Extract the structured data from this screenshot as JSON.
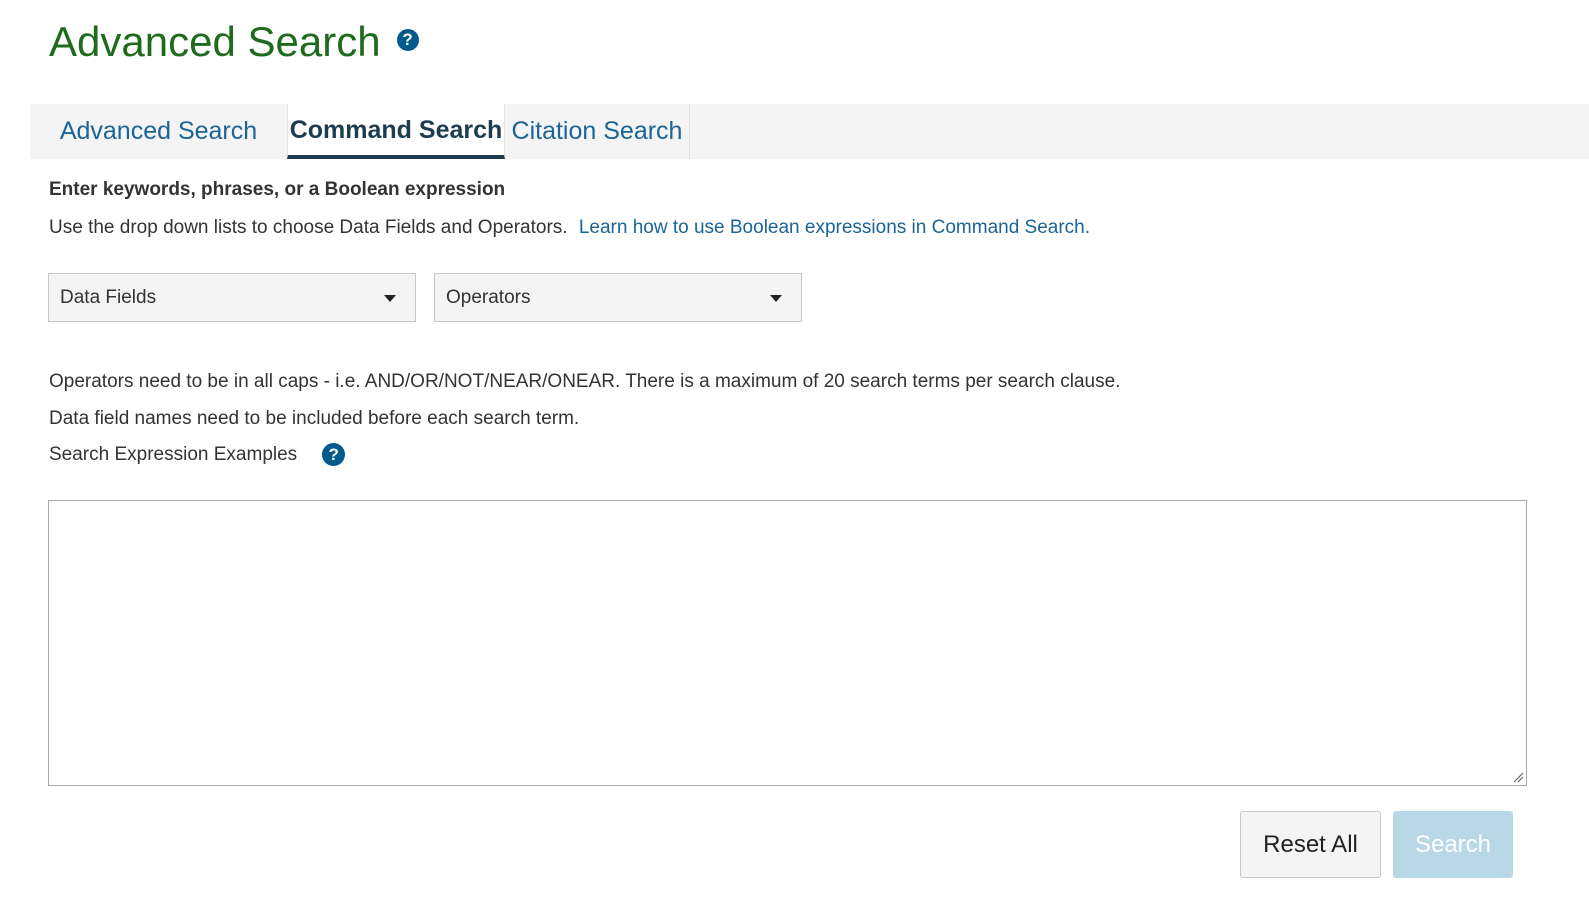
{
  "header": {
    "title": "Advanced Search",
    "help_glyph": "?"
  },
  "tabs": [
    {
      "label": "Advanced Search",
      "active": false
    },
    {
      "label": "Command Search",
      "active": true
    },
    {
      "label": "Citation Search",
      "active": false
    }
  ],
  "instructions": {
    "heading": "Enter keywords, phrases, or a Boolean expression",
    "text": "Use the drop down lists to choose Data Fields and Operators.",
    "link": "Learn how to use Boolean expressions in Command Search."
  },
  "dropdowns": {
    "data_fields": "Data Fields",
    "operators": "Operators"
  },
  "notes": {
    "line1": "Operators need to be in all caps - i.e. AND/OR/NOT/NEAR/ONEAR. There is a maximum of 20 search terms per search clause.",
    "line2": "Data field names need to be included before each search term.",
    "examples": "Search Expression Examples",
    "help_glyph": "?"
  },
  "query": {
    "value": "",
    "placeholder": ""
  },
  "buttons": {
    "reset": "Reset All",
    "search": "Search"
  },
  "colors": {
    "title": "#1e6b1e",
    "link": "#1a6496",
    "active_tab": "#1d3c4f",
    "help_icon": "#005a8c",
    "search_button_disabled": "#b8d8e8"
  },
  "icons": [
    "help-icon",
    "chevron-down-icon",
    "resize-grip-icon"
  ]
}
